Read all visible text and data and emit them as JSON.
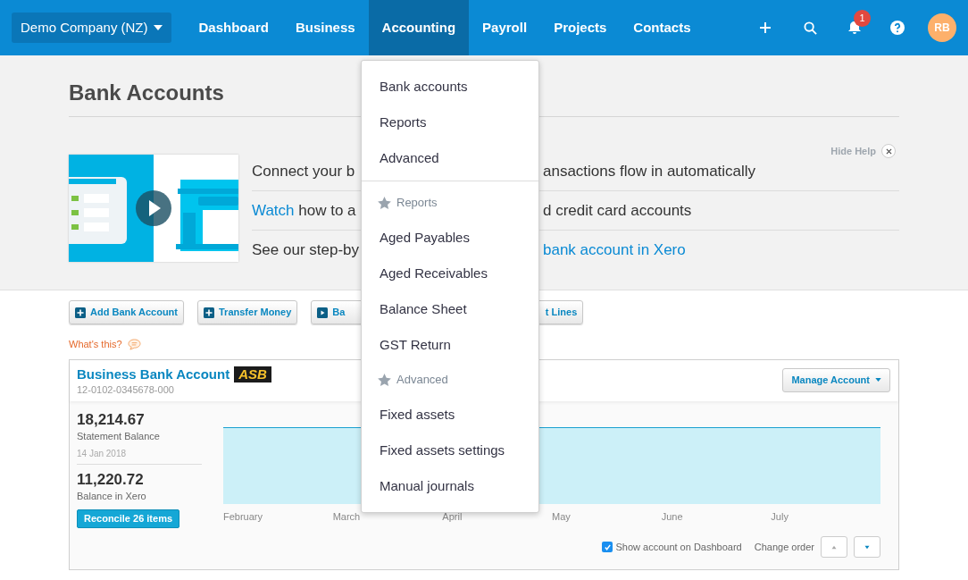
{
  "nav": {
    "org": "Demo Company (NZ)",
    "tabs": [
      {
        "label": "Dashboard",
        "selected": false
      },
      {
        "label": "Business",
        "selected": false
      },
      {
        "label": "Accounting",
        "selected": true
      },
      {
        "label": "Payroll",
        "selected": false
      },
      {
        "label": "Projects",
        "selected": false
      },
      {
        "label": "Contacts",
        "selected": false
      }
    ],
    "notifications": "1",
    "avatar": "RB"
  },
  "page_title": "Bank Accounts",
  "help": {
    "hide_label": "Hide Help",
    "lines": [
      {
        "left": "Connect your b",
        "right": "ansactions flow in automatically"
      },
      {
        "link": "Watch",
        "left": " how to a",
        "right": "d credit card accounts"
      },
      {
        "left": "See our step-by",
        "right_link": "bank account in Xero"
      }
    ]
  },
  "actions": [
    {
      "label": "Add Bank Account"
    },
    {
      "label": "Transfer Money"
    },
    {
      "label": "Ba"
    },
    {
      "label": "t Lines"
    }
  ],
  "whats_this": "What's this?",
  "account": {
    "name": "Business Bank Account",
    "bank": "ASB",
    "number": "12-0102-0345678-000",
    "manage": "Manage Account",
    "statement_balance": "18,214.67",
    "statement_label": "Statement Balance",
    "statement_date": "14 Jan 2018",
    "xero_balance": "11,220.72",
    "xero_label": "Balance in Xero",
    "reconcile": "Reconcile 26 items",
    "months": [
      "February",
      "March",
      "April",
      "May",
      "June",
      "July"
    ],
    "show_on_dashboard": {
      "label": "Show account on Dashboard",
      "checked": true
    },
    "change_order": "Change order"
  },
  "menu": [
    {
      "kind": "item",
      "label": "Bank accounts"
    },
    {
      "kind": "item",
      "label": "Reports"
    },
    {
      "kind": "item",
      "label": "Advanced"
    },
    {
      "kind": "divider"
    },
    {
      "kind": "header",
      "label": "Reports"
    },
    {
      "kind": "item",
      "label": "Aged Payables"
    },
    {
      "kind": "item",
      "label": "Aged Receivables"
    },
    {
      "kind": "item",
      "label": "Balance Sheet"
    },
    {
      "kind": "item",
      "label": "GST Return"
    },
    {
      "kind": "header",
      "label": "Advanced"
    },
    {
      "kind": "item",
      "label": "Fixed assets"
    },
    {
      "kind": "item",
      "label": "Fixed assets settings"
    },
    {
      "kind": "item",
      "label": "Manual journals"
    }
  ]
}
